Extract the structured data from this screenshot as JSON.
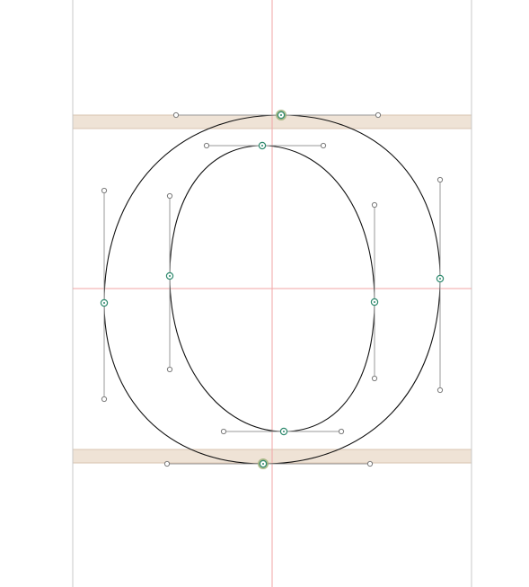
{
  "editor": {
    "glyph_name": "o",
    "colors": {
      "background": "#ffffff",
      "metric_band": "#efe3d6",
      "metric_band_edge": "#d9c4b2",
      "sidebearing": "#c8c8c8",
      "guide_line": "#f2a6a6",
      "contour": "#111111",
      "handle_line": "#9a9a9a",
      "handle_node": "#7a7a7a",
      "on_curve": "#2f8a6e",
      "selected_glow": "#9fb27a"
    }
  }
}
